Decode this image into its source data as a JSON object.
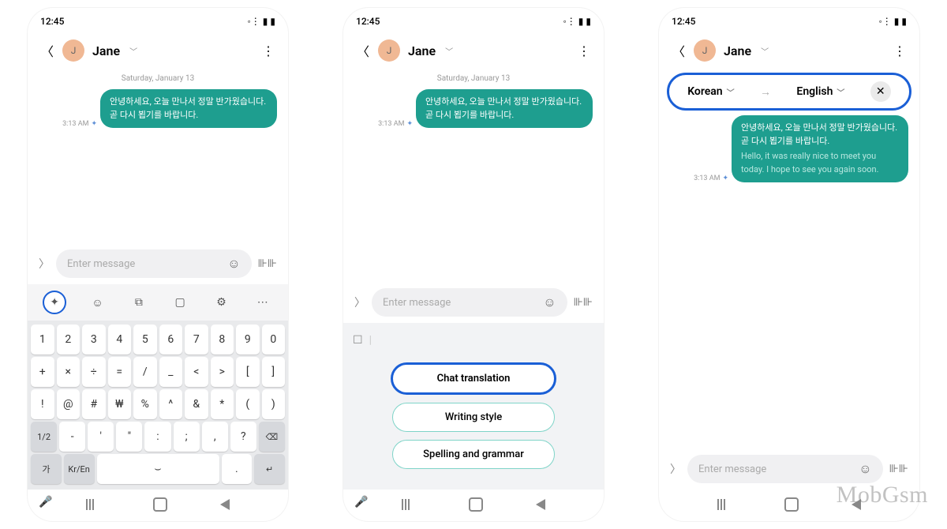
{
  "status": {
    "time": "12:45"
  },
  "header": {
    "contact_name": "Jane",
    "avatar_initial": "J"
  },
  "conversation": {
    "date_label": "Saturday, January 13",
    "msg_time": "3:13 AM",
    "bubble_original": "안녕하세요, 오늘 만나서 정말 반가웠습니다. 곧 다시 뵙기를 바랍니다.",
    "bubble_translation": "Hello, it was really nice to meet you today. I hope to see you again soon."
  },
  "input": {
    "placeholder": "Enter message"
  },
  "ai_menu": {
    "chat_translation": "Chat translation",
    "writing_style": "Writing style",
    "spelling_grammar": "Spelling and grammar"
  },
  "translate_bar": {
    "from": "Korean",
    "to": "English"
  },
  "keyboard": {
    "row1": [
      "1",
      "2",
      "3",
      "4",
      "5",
      "6",
      "7",
      "8",
      "9",
      "0"
    ],
    "row2": [
      "+",
      "×",
      "÷",
      "=",
      "/",
      "_",
      "<",
      ">",
      "[",
      "]"
    ],
    "row3": [
      "!",
      "@",
      "#",
      "₩",
      "%",
      "^",
      "&",
      "*",
      "(",
      ")"
    ],
    "row4_left": "1/2",
    "row4_mid": [
      "-",
      "'",
      "\"",
      ":",
      ";",
      ",",
      "?"
    ],
    "row4_del": "⌫",
    "row5_lang1": "가",
    "row5_lang2": "Kr/En",
    "row5_period": ".",
    "row5_enter": "↵"
  },
  "watermark": "MobGsm"
}
